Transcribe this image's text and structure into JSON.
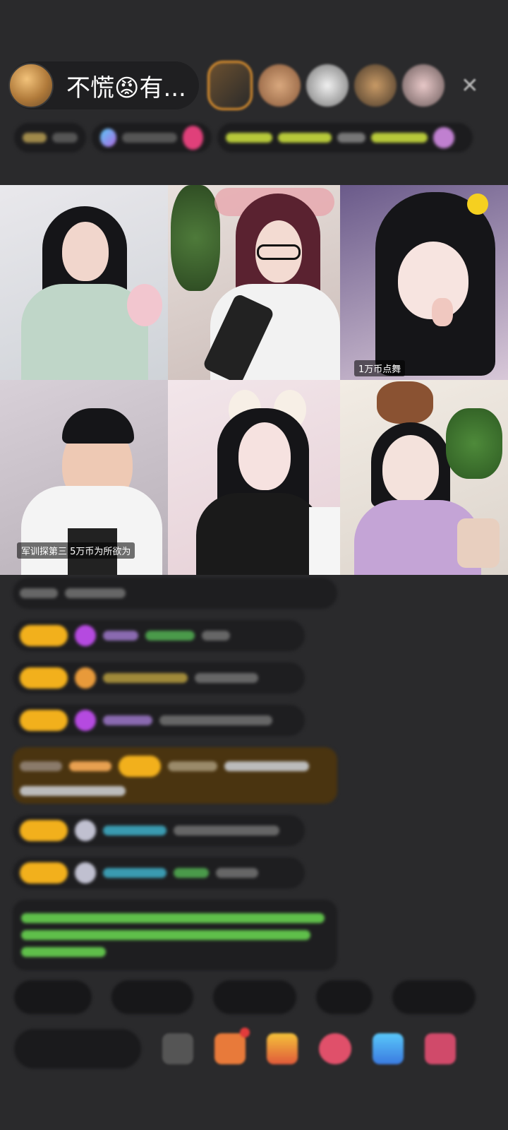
{
  "header": {
    "host_name": "不慌😡有...",
    "close_label": "✕"
  },
  "tiles": [
    {
      "caption": ""
    },
    {
      "caption": ""
    },
    {
      "caption": "1万币点舞"
    },
    {
      "caption": "军训探第三 5万币为所欲为"
    },
    {
      "caption": ""
    },
    {
      "caption": ""
    }
  ],
  "colors": {
    "badge_gold": "#f2b01c",
    "chat_green": "#5fbf4a",
    "chat_brown": "#4a3410"
  }
}
